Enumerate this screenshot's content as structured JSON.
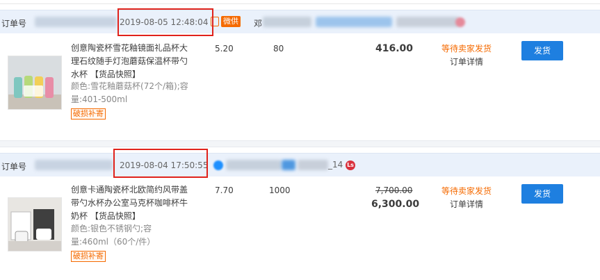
{
  "orders": [
    {
      "header": {
        "order_label": "订单号",
        "time": "2019-08-05 12:48:04",
        "channel_badge": "微供",
        "buyer_initial": "邓"
      },
      "product": {
        "title": "创意陶瓷杯雪花釉镜面礼品杯大理石纹随手灯泡蘑菇保温杯带勺水杯 【货品快照】",
        "spec": "颜色:雪花釉蘑菇杯(72个/箱);容量:401-500ml",
        "tag": "破损补寄",
        "price": "5.20",
        "quantity": "80",
        "total": "416.00",
        "status": "等待卖家发货",
        "detail_link": "订单详情",
        "ship_button": "发货",
        "thumb_icon": "mug-set-icon"
      }
    },
    {
      "header": {
        "order_label": "订单号",
        "time": "2019-08-04 17:50:55",
        "buyer_suffix": "_14",
        "badge_text": "Ls"
      },
      "product": {
        "title": "创意卡通陶瓷杯北欧简约风带盖带勺水杯办公室马克杯咖啡杯牛奶杯 【货品快照】",
        "spec": "颜色:银色不锈钢勺;容量:460ml（60个/件）",
        "tag": "破损补寄",
        "price": "7.70",
        "quantity": "1000",
        "old_total": "7,700.00",
        "total": "6,300.00",
        "status": "等待卖家发货",
        "detail_link": "订单详情",
        "ship_button": "发货",
        "thumb_icon": "mug-boxes-icon"
      }
    }
  ],
  "colors": {
    "accent": "#1e7fe0",
    "warning": "#f56a00",
    "highlight_box": "#e0221b",
    "header_bg": "#eaf1fb"
  }
}
